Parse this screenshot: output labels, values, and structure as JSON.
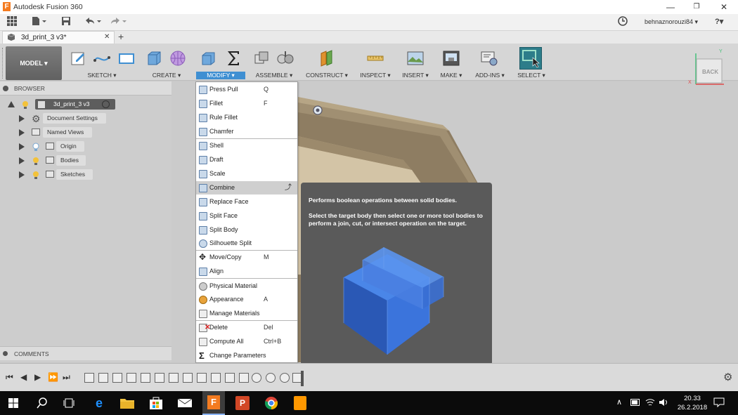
{
  "title_bar": {
    "logo": "F",
    "title": "Autodesk Fusion 360"
  },
  "quick_bar": {
    "user": "behnaznorouzi84 ▾",
    "help": "?▾"
  },
  "tab": {
    "name": "3d_print_3 v3*",
    "close": "✕",
    "add": "+"
  },
  "ribbon": {
    "workspace": "MODEL ▾",
    "groups": [
      "SKETCH ▾",
      "CREATE ▾",
      "MODIFY ▾",
      "ASSEMBLE ▾",
      "CONSTRUCT ▾",
      "INSPECT ▾",
      "INSERT ▾",
      "MAKE ▾",
      "ADD-INS ▾",
      "SELECT ▾"
    ]
  },
  "viewcube": {
    "label": "BACK",
    "axis_y": "Y",
    "axis_x": "X"
  },
  "browser": {
    "header": "BROWSER",
    "root": "3d_print_3 v3",
    "items": [
      "Document Settings",
      "Named Views",
      "Origin",
      "Bodies",
      "Sketches"
    ]
  },
  "comments": {
    "header": "COMMENTS"
  },
  "menu": {
    "items": [
      {
        "label": "Press Pull",
        "shortcut": "Q"
      },
      {
        "label": "Fillet",
        "shortcut": "F"
      },
      {
        "label": "Rule Fillet",
        "shortcut": ""
      },
      {
        "label": "Chamfer",
        "shortcut": ""
      },
      {
        "label": "Shell",
        "shortcut": ""
      },
      {
        "label": "Draft",
        "shortcut": ""
      },
      {
        "label": "Scale",
        "shortcut": ""
      },
      {
        "label": "Combine",
        "shortcut": ""
      },
      {
        "label": "Replace Face",
        "shortcut": ""
      },
      {
        "label": "Split Face",
        "shortcut": ""
      },
      {
        "label": "Split Body",
        "shortcut": ""
      },
      {
        "label": "Silhouette Split",
        "shortcut": ""
      },
      {
        "label": "Move/Copy",
        "shortcut": "M"
      },
      {
        "label": "Align",
        "shortcut": ""
      },
      {
        "label": "Physical Material",
        "shortcut": ""
      },
      {
        "label": "Appearance",
        "shortcut": "A"
      },
      {
        "label": "Manage Materials",
        "shortcut": ""
      },
      {
        "label": "Delete",
        "shortcut": "Del"
      },
      {
        "label": "Compute All",
        "shortcut": "Ctrl+B"
      },
      {
        "label": "Change Parameters",
        "shortcut": ""
      }
    ]
  },
  "tooltip": {
    "line1": "Performs boolean operations between solid bodies.",
    "line2": "Select the target body then select one or more tool bodies to perform a join, cut, or intersect operation on the target."
  },
  "taskbar": {
    "time": "20.33",
    "date": "26.2.2018"
  },
  "colors": {
    "accent": "#3f8fd2",
    "model": "#6a6a6a",
    "tooltip": "#5a5a5a"
  }
}
